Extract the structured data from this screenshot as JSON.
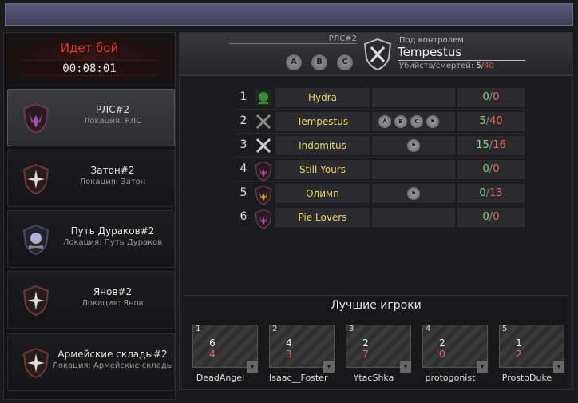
{
  "battle": {
    "title": "Идет бой",
    "time": "00:08:01"
  },
  "locations": [
    {
      "name": "РЛС#2",
      "sub": "Локация: РЛС",
      "active": true,
      "emblem": "crown-emblem"
    },
    {
      "name": "Затон#2",
      "sub": "Локация: Затон",
      "active": false,
      "emblem": "compass-emblem"
    },
    {
      "name": "Путь Дураков#2",
      "sub": "Локация: Путь Дураков",
      "active": false,
      "emblem": "skull-emblem"
    },
    {
      "name": "Янов#2",
      "sub": "Локация: Янов",
      "active": false,
      "emblem": "compass-emblem"
    },
    {
      "name": "Армейские склады#2",
      "sub": "Локация: Армейские склады",
      "active": false,
      "emblem": "compass-emblem"
    }
  ],
  "control": {
    "point_name": "РЛС#2",
    "points": [
      "A",
      "B",
      "C"
    ],
    "label": "Под контролем",
    "team": "Tempestus",
    "kd_label": "Убийств/смертей:",
    "kills": "5",
    "deaths": "40"
  },
  "teams": [
    {
      "rank": "1",
      "name": "Hydra",
      "points": [],
      "kills": "0",
      "deaths": "0",
      "emblem": "hydra-emblem",
      "color": "#3c8a3c"
    },
    {
      "rank": "2",
      "name": "Tempestus",
      "points": [
        "A",
        "B",
        "C",
        "flag"
      ],
      "kills": "5",
      "deaths": "40",
      "emblem": "swords-emblem",
      "color": "#888888"
    },
    {
      "rank": "3",
      "name": "Indomitus",
      "points": [
        "flag"
      ],
      "kills": "15",
      "deaths": "16",
      "emblem": "swords-emblem",
      "color": "#cccccc"
    },
    {
      "rank": "4",
      "name": "Still Yours",
      "points": [],
      "kills": "0",
      "deaths": "0",
      "emblem": "crown-emblem",
      "color": "#a050b0"
    },
    {
      "rank": "5",
      "name": "Олимп",
      "points": [
        "flag"
      ],
      "kills": "0",
      "deaths": "13",
      "emblem": "crown-emblem",
      "color": "#c8a040"
    },
    {
      "rank": "6",
      "name": "Pie Lovers",
      "points": [],
      "kills": "0",
      "deaths": "0",
      "emblem": "crown-emblem",
      "color": "#a050b0"
    }
  ],
  "best_players": {
    "title": "Лучшие игроки",
    "players": [
      {
        "num": "1",
        "kills": "6",
        "deaths": "4",
        "name": "DeadAngel"
      },
      {
        "num": "2",
        "kills": "4",
        "deaths": "3",
        "name": "Isaac__Foster"
      },
      {
        "num": "3",
        "kills": "2",
        "deaths": "7",
        "name": "YtacShka"
      },
      {
        "num": "4",
        "kills": "2",
        "deaths": "0",
        "name": "protogonist"
      },
      {
        "num": "5",
        "kills": "1",
        "deaths": "2",
        "name": "ProstoDuke"
      }
    ]
  },
  "colors": {
    "accent_red": "#e03a2a",
    "team_name": "#e8d66a",
    "kills": "#7ed67a",
    "deaths": "#e06a5a"
  }
}
